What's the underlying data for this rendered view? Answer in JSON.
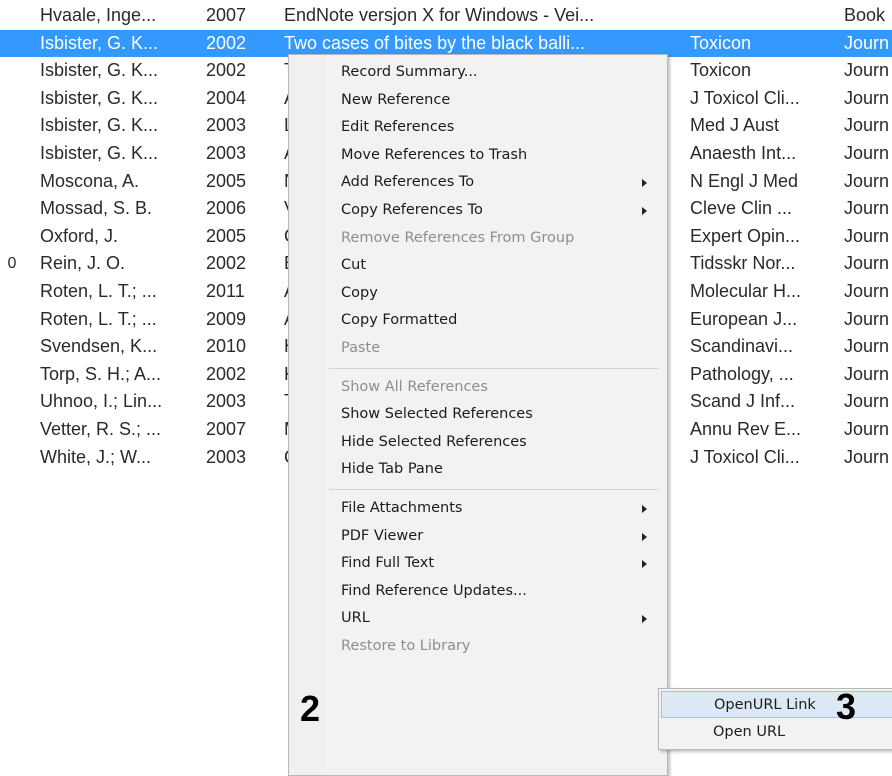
{
  "references": [
    {
      "clip": "",
      "author": "Hvaale, Inge...",
      "year": "2007",
      "title": "EndNote versjon X for Windows - Vei...",
      "journal": "",
      "type": "Book"
    },
    {
      "clip": "",
      "author": "Isbister, G. K...",
      "year": "2002",
      "title": "Two cases of bites by the black balli...",
      "journal": "Toxicon",
      "type": "Journ",
      "selected": true
    },
    {
      "clip": "",
      "author": "Isbister, G. K...",
      "year": "2002",
      "title": "T",
      "journal": "Toxicon",
      "type": "Journ"
    },
    {
      "clip": "",
      "author": "Isbister, G. K...",
      "year": "2004",
      "title": "A",
      "journal": "J Toxicol Cli...",
      "type": "Journ"
    },
    {
      "clip": "",
      "author": "Isbister, G. K...",
      "year": "2003",
      "title": "L",
      "journal": "Med J Aust",
      "type": "Journ"
    },
    {
      "clip": "",
      "author": "Isbister, G. K...",
      "year": "2003",
      "title": "A",
      "journal": "Anaesth Int...",
      "type": "Journ"
    },
    {
      "clip": "",
      "author": "Moscona, A.",
      "year": "2005",
      "title": "N",
      "journal": "N Engl J Med",
      "type": "Journ"
    },
    {
      "clip": "",
      "author": "Mossad, S. B.",
      "year": "2006",
      "title": "V",
      "journal": "Cleve Clin ...",
      "type": "Journ"
    },
    {
      "clip": "",
      "author": "Oxford, J.",
      "year": "2005",
      "title": "C",
      "journal": "Expert Opin...",
      "type": "Journ"
    },
    {
      "clip": "0",
      "author": "Rein, J. O.",
      "year": "2002",
      "title": "E",
      "journal": "Tidsskr Nor...",
      "type": "Journ"
    },
    {
      "clip": "",
      "author": "Roten, L. T.; ...",
      "year": "2011",
      "title": "A",
      "journal": "Molecular H...",
      "type": "Journ"
    },
    {
      "clip": "",
      "author": "Roten, L. T.; ...",
      "year": "2009",
      "title": "A",
      "journal": "European J...",
      "type": "Journ"
    },
    {
      "clip": "",
      "author": "Svendsen, K...",
      "year": "2010",
      "title": "H",
      "journal": "Scandinavi...",
      "type": "Journ"
    },
    {
      "clip": "",
      "author": "Torp, S. H.; A...",
      "year": "2002",
      "title": "K",
      "journal": "Pathology, ...",
      "type": "Journ"
    },
    {
      "clip": "",
      "author": "Uhnoo, I.; Lin...",
      "year": "2003",
      "title": "T",
      "journal": "Scand J Inf...",
      "type": "Journ"
    },
    {
      "clip": "",
      "author": "Vetter, R. S.; ...",
      "year": "2007",
      "title": "M",
      "journal": "Annu Rev E...",
      "type": "Journ"
    },
    {
      "clip": "",
      "author": "White, J.; W...",
      "year": "2003",
      "title": "C",
      "journal": "J Toxicol Cli...",
      "type": "Journ"
    }
  ],
  "context_menu": [
    {
      "label": "Record Summary...",
      "name": "menu-record-summary"
    },
    {
      "label": "New Reference",
      "name": "menu-new-reference"
    },
    {
      "label": "Edit References",
      "name": "menu-edit-references"
    },
    {
      "label": "Move References to Trash",
      "name": "menu-move-to-trash"
    },
    {
      "label": "Add References To",
      "name": "menu-add-references-to",
      "submenu": true
    },
    {
      "label": "Copy References To",
      "name": "menu-copy-references-to",
      "submenu": true
    },
    {
      "label": "Remove References From Group",
      "name": "menu-remove-from-group",
      "disabled": true
    },
    {
      "label": "Cut",
      "name": "menu-cut"
    },
    {
      "label": "Copy",
      "name": "menu-copy"
    },
    {
      "label": "Copy Formatted",
      "name": "menu-copy-formatted"
    },
    {
      "label": "Paste",
      "name": "menu-paste",
      "disabled": true
    },
    {
      "separator": true
    },
    {
      "label": "Show All References",
      "name": "menu-show-all-references",
      "disabled": true
    },
    {
      "label": "Show Selected References",
      "name": "menu-show-selected-references"
    },
    {
      "label": "Hide Selected References",
      "name": "menu-hide-selected-references"
    },
    {
      "label": "Hide Tab Pane",
      "name": "menu-hide-tab-pane"
    },
    {
      "separator": true
    },
    {
      "label": "File Attachments",
      "name": "menu-file-attachments",
      "submenu": true
    },
    {
      "label": "PDF Viewer",
      "name": "menu-pdf-viewer",
      "submenu": true
    },
    {
      "label": "Find Full Text",
      "name": "menu-find-full-text",
      "submenu": true
    },
    {
      "label": "Find Reference Updates...",
      "name": "menu-find-reference-updates"
    },
    {
      "label": "URL",
      "name": "menu-url",
      "submenu": true,
      "active": true
    },
    {
      "label": "Restore to Library",
      "name": "menu-restore-to-library",
      "disabled": true
    }
  ],
  "url_submenu": [
    {
      "label": "OpenURL Link",
      "name": "submenu-openurl-link",
      "hover": true
    },
    {
      "label": "Open URL",
      "name": "submenu-open-url"
    }
  ],
  "callouts": {
    "step2": "2",
    "step3": "3"
  },
  "colors": {
    "selection": "#3399ff",
    "menu_bg": "#f2f2f2",
    "hover": "#dde8f5"
  }
}
